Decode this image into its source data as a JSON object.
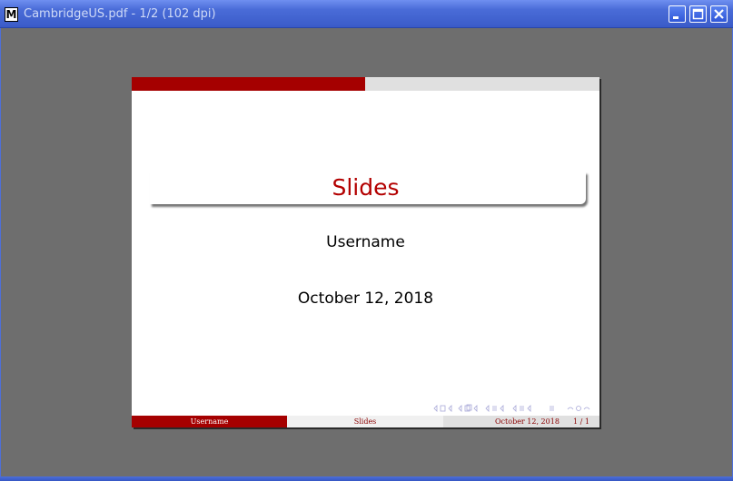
{
  "window": {
    "title": "CambridgeUS.pdf - 1/2 (102 dpi)"
  },
  "slide": {
    "title": "Slides",
    "author": "Username",
    "date": "October 12, 2018"
  },
  "footer": {
    "author": "Username",
    "title": "Slides",
    "date": "October 12, 2018",
    "page": "1 / 1"
  },
  "colors": {
    "titlebar": "#3a5bc8",
    "viewer_bg": "#6e6e6e",
    "beamer_red": "#a50000",
    "title_red": "#b30000"
  },
  "icons": [
    "app-icon",
    "minimize-icon",
    "maximize-icon",
    "close-icon",
    "beamer-navigation-icons"
  ]
}
